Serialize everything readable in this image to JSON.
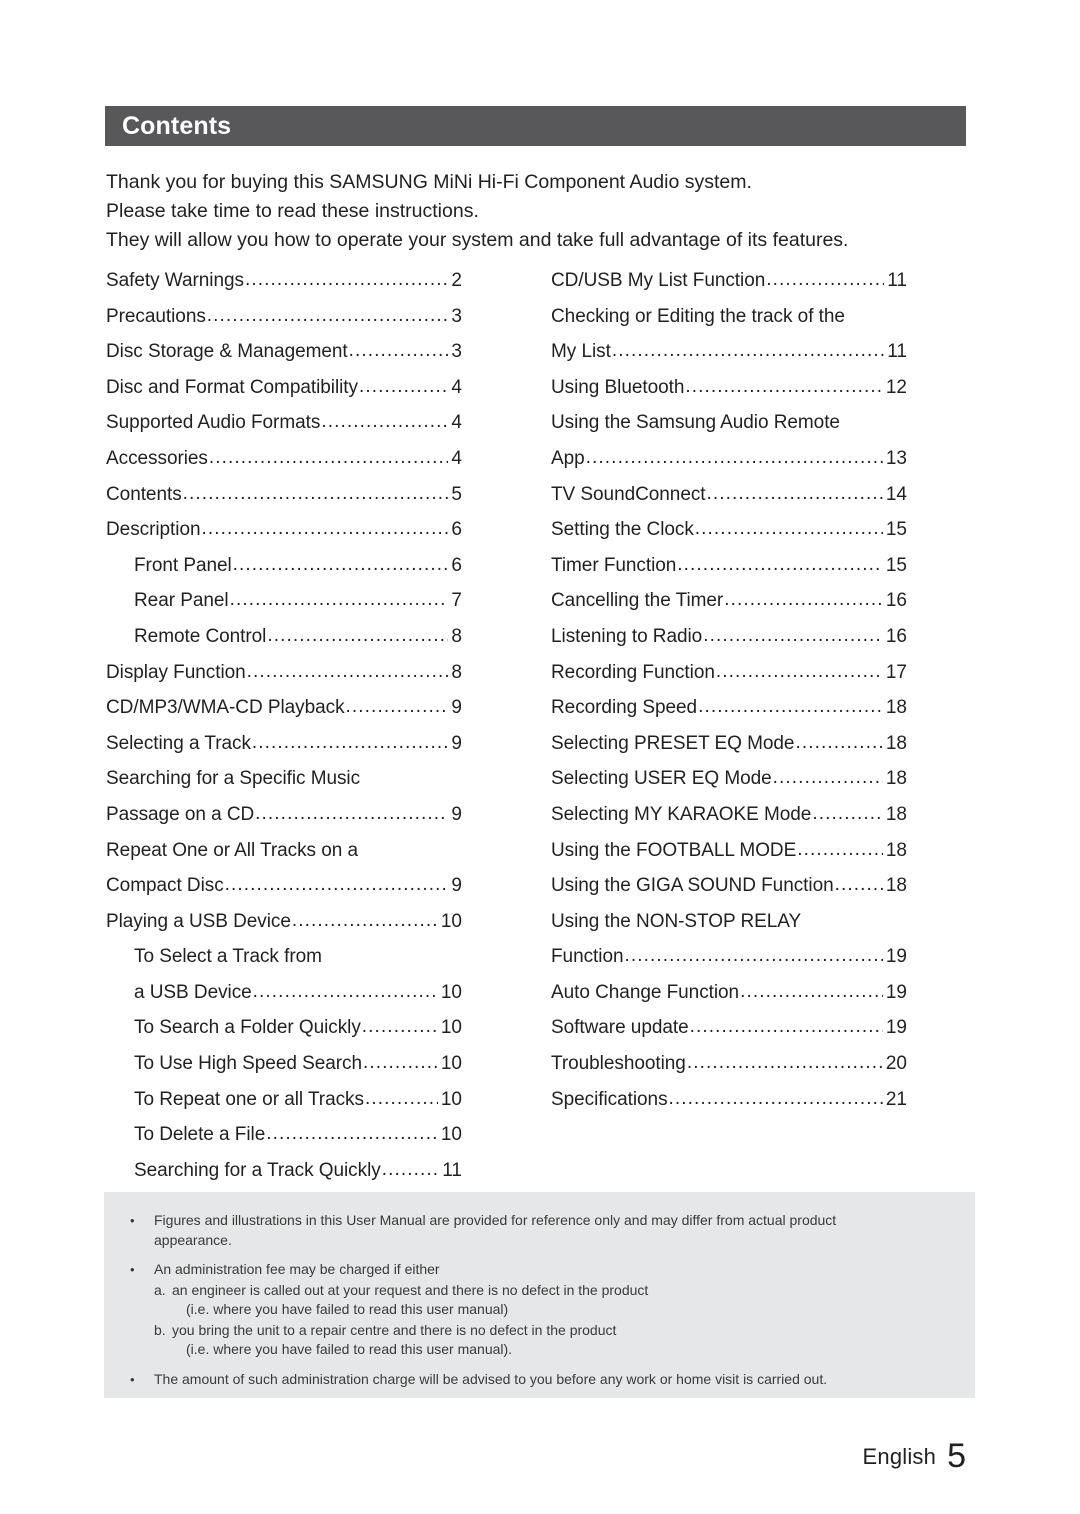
{
  "header": {
    "title": "Contents"
  },
  "intro": {
    "lines": [
      "Thank you for buying this SAMSUNG MiNi Hi-Fi Component Audio system.",
      "Please take time to read these instructions.",
      "They will allow you how to operate your system and take full advantage of its features."
    ]
  },
  "toc": {
    "left": [
      {
        "label": "Safety Warnings",
        "page": "2",
        "indent": false,
        "dots": true
      },
      {
        "label": "Precautions",
        "page": "3",
        "indent": false,
        "dots": true
      },
      {
        "label": "Disc Storage & Management",
        "page": "3",
        "indent": false,
        "dots": true
      },
      {
        "label": "Disc and Format Compatibility",
        "page": "4",
        "indent": false,
        "dots": true
      },
      {
        "label": "Supported Audio Formats",
        "page": "4",
        "indent": false,
        "dots": true
      },
      {
        "label": "Accessories",
        "page": "4",
        "indent": false,
        "dots": true
      },
      {
        "label": "Contents",
        "page": "5",
        "indent": false,
        "dots": true
      },
      {
        "label": "Description",
        "page": "6",
        "indent": false,
        "dots": true
      },
      {
        "label": "Front Panel",
        "page": "6",
        "indent": true,
        "dots": true
      },
      {
        "label": "Rear Panel",
        "page": "7",
        "indent": true,
        "dots": true
      },
      {
        "label": "Remote Control",
        "page": "8",
        "indent": true,
        "dots": true
      },
      {
        "label": "Display Function",
        "page": "8",
        "indent": false,
        "dots": true
      },
      {
        "label": "CD/MP3/WMA-CD Playback",
        "page": "9",
        "indent": false,
        "dots": true
      },
      {
        "label": "Selecting a Track",
        "page": "9",
        "indent": false,
        "dots": true
      },
      {
        "label": "Searching for a Specific Music",
        "page": "",
        "indent": false,
        "dots": false
      },
      {
        "label": "Passage on a CD",
        "page": "9",
        "indent": false,
        "dots": true
      },
      {
        "label": "Repeat One or All Tracks on a",
        "page": "",
        "indent": false,
        "dots": false
      },
      {
        "label": "Compact Disc",
        "page": "9",
        "indent": false,
        "dots": true
      },
      {
        "label": "Playing a USB Device",
        "page": "10",
        "indent": false,
        "dots": true
      },
      {
        "label": "To Select a Track from",
        "page": "",
        "indent": true,
        "dots": false
      },
      {
        "label": "a USB Device",
        "page": "10",
        "indent": true,
        "dots": true
      },
      {
        "label": "To Search a Folder Quickly",
        "page": "10",
        "indent": true,
        "dots": true
      },
      {
        "label": "To Use High Speed Search",
        "page": "10",
        "indent": true,
        "dots": true
      },
      {
        "label": "To Repeat one or all Tracks",
        "page": "10",
        "indent": true,
        "dots": true
      },
      {
        "label": "To Delete a File",
        "page": "10",
        "indent": true,
        "dots": true
      },
      {
        "label": "Searching for a Track Quickly",
        "page": "11",
        "indent": true,
        "dots": true
      }
    ],
    "right": [
      {
        "label": "CD/USB My List Function",
        "page": "11",
        "indent": false,
        "dots": true
      },
      {
        "label": "Checking or Editing the track of the",
        "page": "",
        "indent": false,
        "dots": false
      },
      {
        "label": "My List",
        "page": "11",
        "indent": false,
        "dots": true
      },
      {
        "label": "Using Bluetooth",
        "page": "12",
        "indent": false,
        "dots": true
      },
      {
        "label": "Using the Samsung Audio Remote",
        "page": "",
        "indent": false,
        "dots": false
      },
      {
        "label": "App",
        "page": "13",
        "indent": false,
        "dots": true
      },
      {
        "label": "TV SoundConnect",
        "page": "14",
        "indent": false,
        "dots": true
      },
      {
        "label": "Setting the Clock",
        "page": "15",
        "indent": false,
        "dots": true
      },
      {
        "label": "Timer Function",
        "page": "15",
        "indent": false,
        "dots": true
      },
      {
        "label": "Cancelling the Timer",
        "page": "16",
        "indent": false,
        "dots": true
      },
      {
        "label": "Listening to Radio",
        "page": "16",
        "indent": false,
        "dots": true
      },
      {
        "label": "Recording Function",
        "page": "17",
        "indent": false,
        "dots": true
      },
      {
        "label": "Recording Speed",
        "page": "18",
        "indent": false,
        "dots": true
      },
      {
        "label": "Selecting  PRESET EQ Mode",
        "page": "18",
        "indent": false,
        "dots": true
      },
      {
        "label": "Selecting  USER EQ Mode",
        "page": "18",
        "indent": false,
        "dots": true
      },
      {
        "label": "Selecting  MY KARAOKE Mode",
        "page": "18",
        "indent": false,
        "dots": true
      },
      {
        "label": "Using the FOOTBALL MODE",
        "page": "18",
        "indent": false,
        "dots": true
      },
      {
        "label": "Using the GIGA SOUND Function",
        "page": "18",
        "indent": false,
        "dots": true
      },
      {
        "label": "Using the NON-STOP RELAY",
        "page": "",
        "indent": false,
        "dots": false
      },
      {
        "label": "Function",
        "page": "19",
        "indent": false,
        "dots": true
      },
      {
        "label": "Auto Change Function",
        "page": "19",
        "indent": false,
        "dots": true
      },
      {
        "label": "Software update",
        "page": "19",
        "indent": false,
        "dots": true
      },
      {
        "label": "Troubleshooting",
        "page": "20",
        "indent": false,
        "dots": true
      },
      {
        "label": "Specifications",
        "page": "21",
        "indent": false,
        "dots": true
      }
    ]
  },
  "notes": {
    "bullet_glyph": "•",
    "items": [
      {
        "lines": [
          "Figures and illustrations in this User Manual are provided for reference only and may differ from actual product",
          "appearance."
        ],
        "sub": []
      },
      {
        "lines": [
          "An administration fee may be charged if either"
        ],
        "sub": [
          {
            "marker": "a.",
            "lines": [
              "an engineer is called out at your request and there is no defect in the product",
              "(i.e. where you have failed to read this user manual)"
            ]
          },
          {
            "marker": "b.",
            "lines": [
              "you bring the unit to a repair centre and there is no defect in the product",
              "(i.e. where you have failed to read this user manual)."
            ]
          }
        ]
      },
      {
        "lines": [
          "The amount of such administration charge will be advised to you before any work or home visit is carried out."
        ],
        "sub": []
      }
    ]
  },
  "footer": {
    "language": "English",
    "page_number": "5"
  },
  "colors": {
    "header_bar": "#58585a",
    "header_text": "#ffffff",
    "body_text": "#231f20",
    "notes_background": "#e6e7e8",
    "notes_text": "#3a3a3a",
    "page_background": "#ffffff"
  }
}
